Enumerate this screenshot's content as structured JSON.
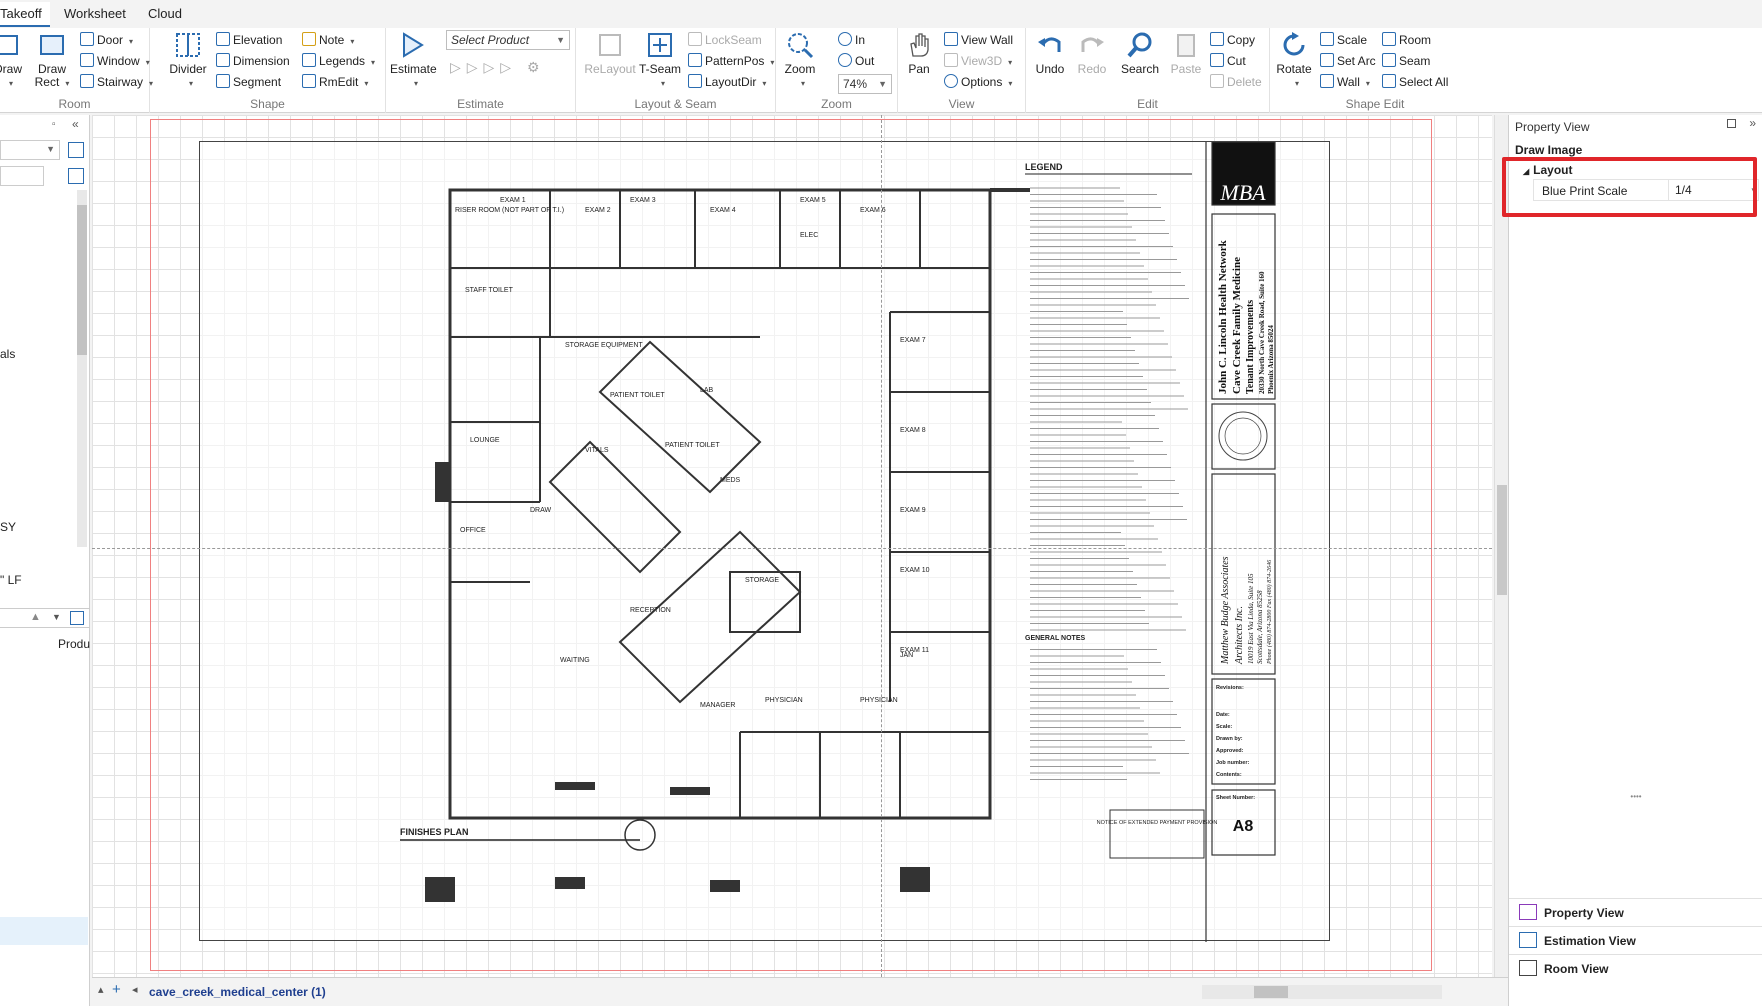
{
  "tabs": [
    "Takeoff",
    "Worksheet",
    "Cloud"
  ],
  "ribbon": {
    "room": {
      "label": "Room",
      "draw": "Draw",
      "draw_rect": "Draw Rect",
      "door": "Door",
      "window": "Window",
      "stairway": "Stairway"
    },
    "shape": {
      "label": "Shape",
      "divider": "Divider",
      "elevation": "Elevation",
      "dimension": "Dimension",
      "segment": "Segment",
      "note": "Note",
      "legends": "Legends",
      "rmedit": "RmEdit"
    },
    "estimate": {
      "label": "Estimate",
      "estimate": "Estimate",
      "select_placeholder": "Select Product"
    },
    "layout_seam": {
      "label": "Layout & Seam",
      "relayout": "ReLayout",
      "tseam": "T-Seam",
      "lockseam": "LockSeam",
      "patternpos": "PatternPos",
      "layoutdir": "LayoutDir"
    },
    "zoom": {
      "label": "Zoom",
      "zoom": "Zoom",
      "in": "In",
      "out": "Out",
      "level": "74%"
    },
    "view": {
      "label": "View",
      "pan": "Pan",
      "view_wall": "View Wall",
      "view3d": "View3D",
      "options": "Options"
    },
    "edit": {
      "label": "Edit",
      "undo": "Undo",
      "redo": "Redo",
      "search": "Search",
      "paste": "Paste",
      "copy": "Copy",
      "cut": "Cut",
      "delete": "Delete"
    },
    "shape_edit": {
      "label": "Shape Edit",
      "rotate": "Rotate",
      "scale": "Scale",
      "set_arc": "Set Arc",
      "wall": "Wall",
      "room": "Room",
      "seam": "Seam",
      "select_all": "Select All"
    }
  },
  "left_panel": {
    "items": [
      "als",
      "SY",
      "\" LF"
    ],
    "column_header": "Produ"
  },
  "canvas": {
    "sheet_tab": "cave_creek_medical_center (1)"
  },
  "property_view": {
    "title": "Property View",
    "subtitle": "Draw Image",
    "section": "Layout",
    "row_key": "Blue Print Scale",
    "row_value": "1/4",
    "tabs": [
      "Property View",
      "Estimation View",
      "Room View"
    ]
  },
  "blueprint": {
    "legend_title": "LEGEND",
    "plan_title": "FINISHES PLAN",
    "project": [
      "John C. Lincoln Health Network",
      "Cave Creek Family Medicine",
      "Tenant Improvements",
      "20330 North Cave Creek Road, Suite 160",
      "Phoenix Arizona 85024"
    ],
    "architect": [
      "Matthew Budge Associates",
      "Architects Inc.",
      "10019 East Via Linda, Suite 105",
      "Scottsdale, Arizona 85258",
      "Phone (480) 874-2800  Fax (480) 874-2646"
    ],
    "logo": "MBA",
    "general_notes": "GENERAL NOTES",
    "revisions": "Revisions:",
    "title_fields": [
      "Date:",
      "Scale:",
      "Drawn by:",
      "Approved:",
      "Job number:",
      "Contents:"
    ],
    "sheet_number_label": "Sheet Number:",
    "sheet_number": "A8",
    "notice": "NOTICE OF EXTENDED PAYMENT PROVISION",
    "rooms": [
      {
        "n": "RISER ROOM (NOT PART OF T.I.)"
      },
      {
        "n": "EXAM 1"
      },
      {
        "n": "EXAM 2"
      },
      {
        "n": "EXAM 3"
      },
      {
        "n": "EXAM 4"
      },
      {
        "n": "EXAM 5"
      },
      {
        "n": "EXAM 6"
      },
      {
        "n": "EXAM 7"
      },
      {
        "n": "EXAM 8"
      },
      {
        "n": "EXAM 9"
      },
      {
        "n": "EXAM 10"
      },
      {
        "n": "EXAM 11"
      },
      {
        "n": "STAFF TOILET"
      },
      {
        "n": "STORAGE EQUIPMENT"
      },
      {
        "n": "PATIENT TOILET"
      },
      {
        "n": "PATIENT TOILET"
      },
      {
        "n": "LOUNGE"
      },
      {
        "n": "VITALS"
      },
      {
        "n": "LAB"
      },
      {
        "n": "MEDS"
      },
      {
        "n": "DRAW"
      },
      {
        "n": "STORAGE"
      },
      {
        "n": "RECEPTION"
      },
      {
        "n": "WAITING"
      },
      {
        "n": "MANAGER"
      },
      {
        "n": "PHYSICIAN"
      },
      {
        "n": "PHYSICIAN"
      },
      {
        "n": "JAN"
      },
      {
        "n": "ELEC"
      },
      {
        "n": "OFFICE"
      }
    ]
  }
}
